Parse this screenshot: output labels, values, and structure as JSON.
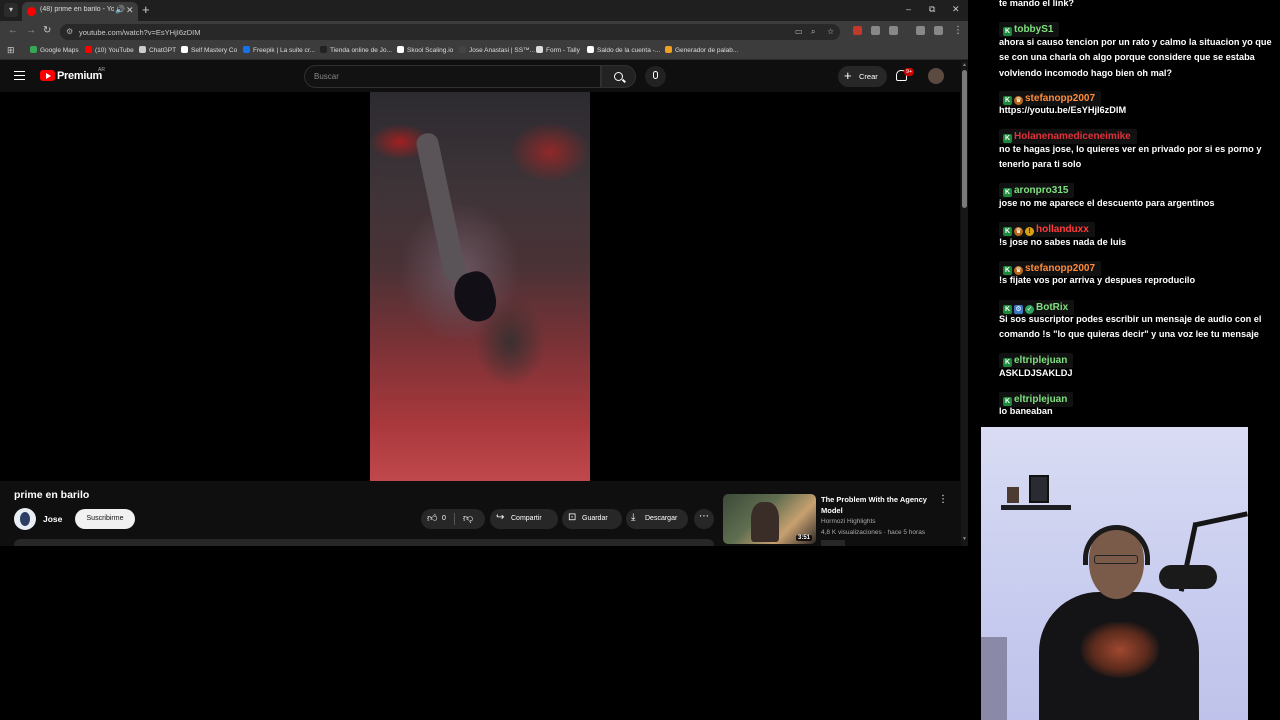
{
  "browser": {
    "tab": {
      "title": "(48) prime en barilo - YouT"
    },
    "window_controls": [
      "–",
      "⧉",
      "✕"
    ],
    "url": "youtube.com/watch?v=EsYHjI6zDIM",
    "bookmarks": [
      {
        "label": "Google Maps",
        "color": "#34a853"
      },
      {
        "label": "(10) YouTube",
        "color": "#ff0000"
      },
      {
        "label": "ChatGPT",
        "color": "#cccccc"
      },
      {
        "label": "Self Mastery Co",
        "color": "#ffffff"
      },
      {
        "label": "Freepik | La suite cr...",
        "color": "#1273eb"
      },
      {
        "label": "Tienda online de Jo...",
        "color": "#222222"
      },
      {
        "label": "Skool Scaling.io",
        "color": "#ffffff"
      },
      {
        "label": "Jose Anastasi | SS™...",
        "color": "#444444"
      },
      {
        "label": "Form - Tally",
        "color": "#dddddd"
      },
      {
        "label": "Saldo de la cuenta -...",
        "color": "#ffffff"
      },
      {
        "label": "Generador de palab...",
        "color": "#f0a020"
      }
    ]
  },
  "youtube": {
    "brand": "Premium",
    "region": "AR",
    "search_placeholder": "Buscar",
    "create_label": "Crear",
    "notifications": "9+",
    "video": {
      "title": "prime en barilo",
      "channel": "Jose",
      "subscribe_label": "Suscribirme",
      "likes": "0",
      "share_label": "Compartir",
      "save_label": "Guardar",
      "download_label": "Descargar"
    },
    "recommended": {
      "title": "The Problem With the Agency Model",
      "channel": "Hormozi Highlights",
      "meta": "4,8 K visualizaciones · hace 5 horas",
      "duration": "3:51"
    }
  },
  "chat": {
    "first_line": "te mando el link?",
    "messages": [
      {
        "user": "tobbyS1",
        "color": "#7ee07e",
        "badges": [
          "k"
        ],
        "text": "ahora si causo tencion por un rato y calmo la situacion yo que se con una charla oh algo porque considere que se estaba volviendo incomodo hago bien oh mal?"
      },
      {
        "user": "stefanopp2007",
        "color": "#ff8c3a",
        "badges": [
          "k",
          "crown"
        ],
        "text": "https://youtu.be/EsYHjI6zDIM"
      },
      {
        "user": "Holanenamediceneimike",
        "color": "#e0303a",
        "badges": [
          "k"
        ],
        "text": "no te hagas jose, lo quieres ver en privado por si es porno y tenerlo para ti solo"
      },
      {
        "user": "aronpro315",
        "color": "#7ee07e",
        "badges": [
          "k"
        ],
        "text": "jose no me aparece el descuento para argentinos"
      },
      {
        "user": "hollanduxx",
        "color": "#ff3b3b",
        "badges": [
          "k",
          "crown",
          "coin"
        ],
        "text": "!s jose no sabes nada de luis"
      },
      {
        "user": "stefanopp2007",
        "color": "#ff8c3a",
        "badges": [
          "k",
          "crown"
        ],
        "text": "!s fijate vos por arriva y despues reproducilo"
      },
      {
        "user": "BotRix",
        "color": "#7ee07e",
        "badges": [
          "k",
          "bot",
          "check"
        ],
        "text": "Si sos suscriptor podes escribir un mensaje de audio con el comando !s \"lo que quieras decir\" y una voz lee tu mensaje"
      },
      {
        "user": "eltriplejuan",
        "color": "#7ee07e",
        "badges": [
          "k"
        ],
        "text": "ASKLDJSAKLDJ"
      },
      {
        "user": "eltriplejuan",
        "color": "#7ee07e",
        "badges": [
          "k"
        ],
        "text": "lo baneaban"
      }
    ]
  }
}
